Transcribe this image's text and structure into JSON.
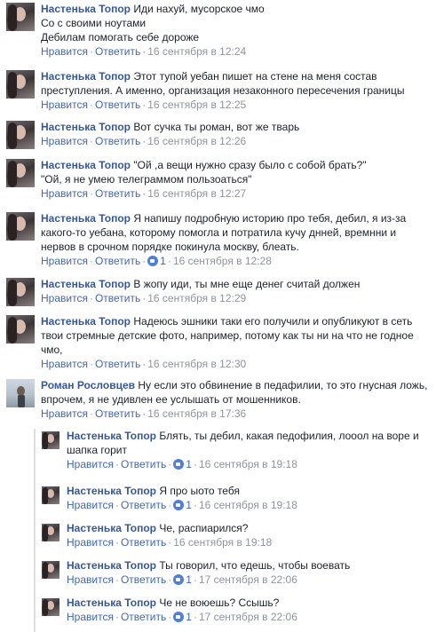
{
  "labels": {
    "like": "Нравится",
    "reply": "Ответить",
    "sep": "·"
  },
  "comments": [
    {
      "author": "Настенька Топор",
      "lines": [
        "Иди нахуй, мусорское чмо",
        "Со с своими ноутами",
        "Дебилам помогать себе дороже"
      ],
      "likes": null,
      "time": "16 сентября в 12:24"
    },
    {
      "author": "Настенька Топор",
      "lines": [
        "Этот тупой уебан пишет на стене на меня состав",
        "преступления. А именно, организация незаконного пересечения границы"
      ],
      "likes": null,
      "time": "16 сентября в 12:25"
    },
    {
      "author": "Настенька Топор",
      "lines": [
        "Вот сучка ты роман, вот же тварь"
      ],
      "likes": null,
      "time": "16 сентября в 12:26"
    },
    {
      "author": "Настенька Топор",
      "lines": [
        "\"Ой ,а вещи нужно сразу было с собой брать?\"",
        "\"Ой, я не умею телеграммом пользоаться\""
      ],
      "likes": null,
      "time": "16 сентября в 12:27"
    },
    {
      "author": "Настенька Топор",
      "lines": [
        "Я напишу подробную историю про тебя, дебил, я из-за",
        "какого-то уебана, которому помогла и потратила кучу днней, времнни и",
        "нервов в срочном порядке покинула москву, блеать."
      ],
      "likes": "1",
      "time": "16 сентября в 12:28"
    },
    {
      "author": "Настенька Топор",
      "lines": [
        "В жопу иди, ты мне еще денег считай должен"
      ],
      "likes": null,
      "time": "16 сентября в 12:29"
    },
    {
      "author": "Настенька Топор",
      "lines": [
        "Надеюсь эшники таки его получили и опубликуют в сеть",
        "твои стремные детские фото, например, потому как ты ни на что не годное",
        "чмо,"
      ],
      "likes": null,
      "time": "16 сентября в 12:30"
    },
    {
      "author": "Роман Рословцев",
      "lines": [
        "Ну если это обвинение в педафилии, то это гнусная ложь,",
        "впрочем, я не удивлен ее услышать от мошенников."
      ],
      "likes": null,
      "time": "16 сентября в 17:36"
    }
  ],
  "replies": [
    {
      "author": "Настенька Топор",
      "lines": [
        "Блять, ты дебил, какая педофилия, лооол на воре и",
        "шапка горит"
      ],
      "likes": "1",
      "time": "16 сентября в 19:18"
    },
    {
      "author": "Настенька Топор",
      "lines": [
        "Я про ыото тебя"
      ],
      "likes": "1",
      "time": "16 сентября в 19:18"
    },
    {
      "author": "Настенька Топор",
      "lines": [
        "Че, распиарился?"
      ],
      "likes": null,
      "time": "16 сентября в 19:18"
    },
    {
      "author": "Настенька Топор",
      "lines": [
        "Ты говорил, что едешь, чтобы воевать"
      ],
      "likes": "1",
      "time": "17 сентября в 22:06"
    },
    {
      "author": "Настенька Топор",
      "lines": [
        "Че не воюешь? Ссышь?"
      ],
      "likes": "1",
      "time": "17 сентября в 22:06"
    }
  ]
}
